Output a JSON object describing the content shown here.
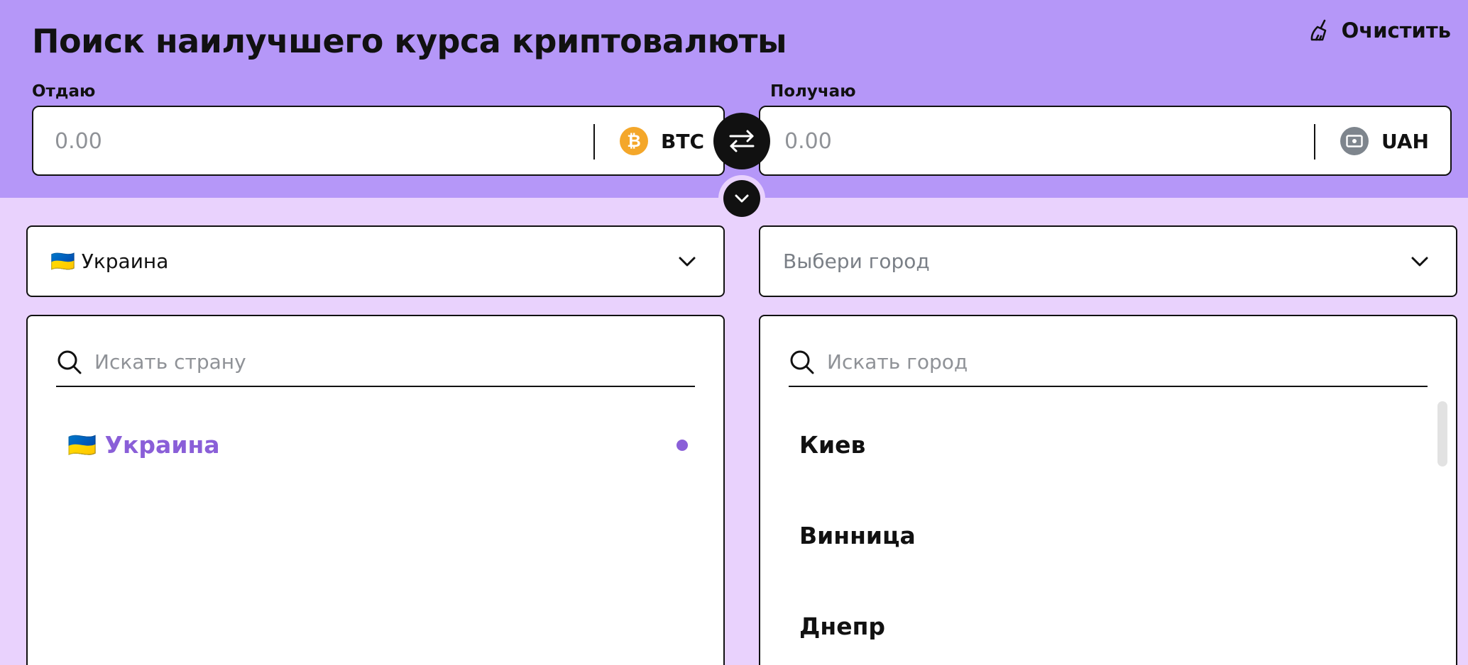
{
  "header": {
    "title": "Поиск наилучшего курса криптовалюты",
    "clear_label": "Очистить"
  },
  "give": {
    "label": "Отдаю",
    "placeholder": "0.00",
    "currency": "BTC",
    "currency_symbol": "₿",
    "currency_color": "#f4a72a"
  },
  "receive": {
    "label": "Получаю",
    "placeholder": "0.00",
    "currency": "UAH",
    "currency_color": "#7e858d"
  },
  "country_select": {
    "flag": "🇺🇦",
    "value": "Украина"
  },
  "city_select": {
    "placeholder": "Выбери город"
  },
  "country_panel": {
    "search_placeholder": "Искать страну",
    "items": [
      {
        "flag": "🇺🇦",
        "label": "Украина",
        "selected": true
      }
    ]
  },
  "city_panel": {
    "search_placeholder": "Искать город",
    "items": [
      {
        "label": "Киев"
      },
      {
        "label": "Винница"
      },
      {
        "label": "Днепр"
      }
    ]
  },
  "colors": {
    "header_bg": "#b597f8",
    "page_bg": "#e9d2fd",
    "accent": "#8a5fd8"
  }
}
